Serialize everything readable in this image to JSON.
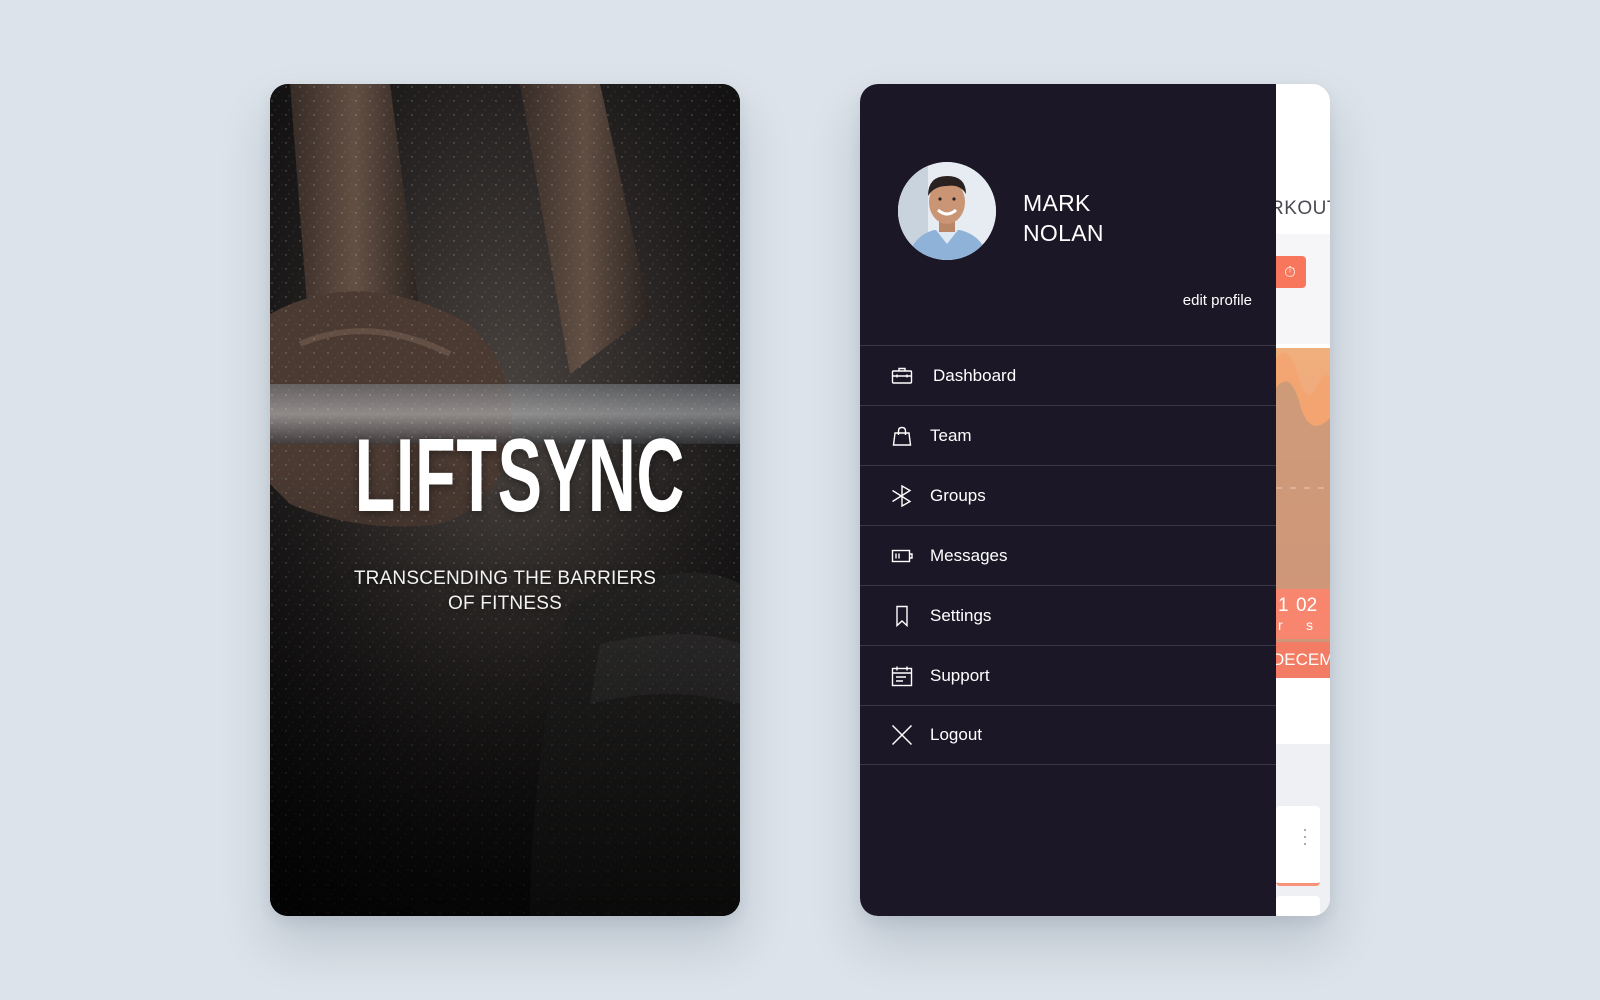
{
  "splash": {
    "title": "LIFTSYNC",
    "tagline": "TRANSCENDING THE BARRIERS OF FITNESS"
  },
  "drawer": {
    "user": {
      "first_name": "MARK",
      "last_name": "NOLAN",
      "edit_label": "edit profile"
    },
    "menu": [
      {
        "label": "Dashboard",
        "icon": "briefcase-icon"
      },
      {
        "label": "Team",
        "icon": "shopping-bag-icon"
      },
      {
        "label": "Groups",
        "icon": "bluetooth-icon"
      },
      {
        "label": "Messages",
        "icon": "battery-icon"
      },
      {
        "label": "Settings",
        "icon": "bookmark-icon"
      },
      {
        "label": "Support",
        "icon": "calendar-icon"
      },
      {
        "label": "Logout",
        "icon": "close-icon"
      }
    ]
  },
  "background_app": {
    "header_fragment": "RKOUT",
    "timer_fragment_a": "1",
    "timer_fragment_b": "02",
    "timer_unit_a": "r",
    "timer_unit_b": "s",
    "month_fragment": "DECEMB"
  },
  "colors": {
    "page_bg": "#dce3ea",
    "drawer_bg": "#1b1726",
    "divider": "#3b3749",
    "accent": "#f7765c"
  }
}
